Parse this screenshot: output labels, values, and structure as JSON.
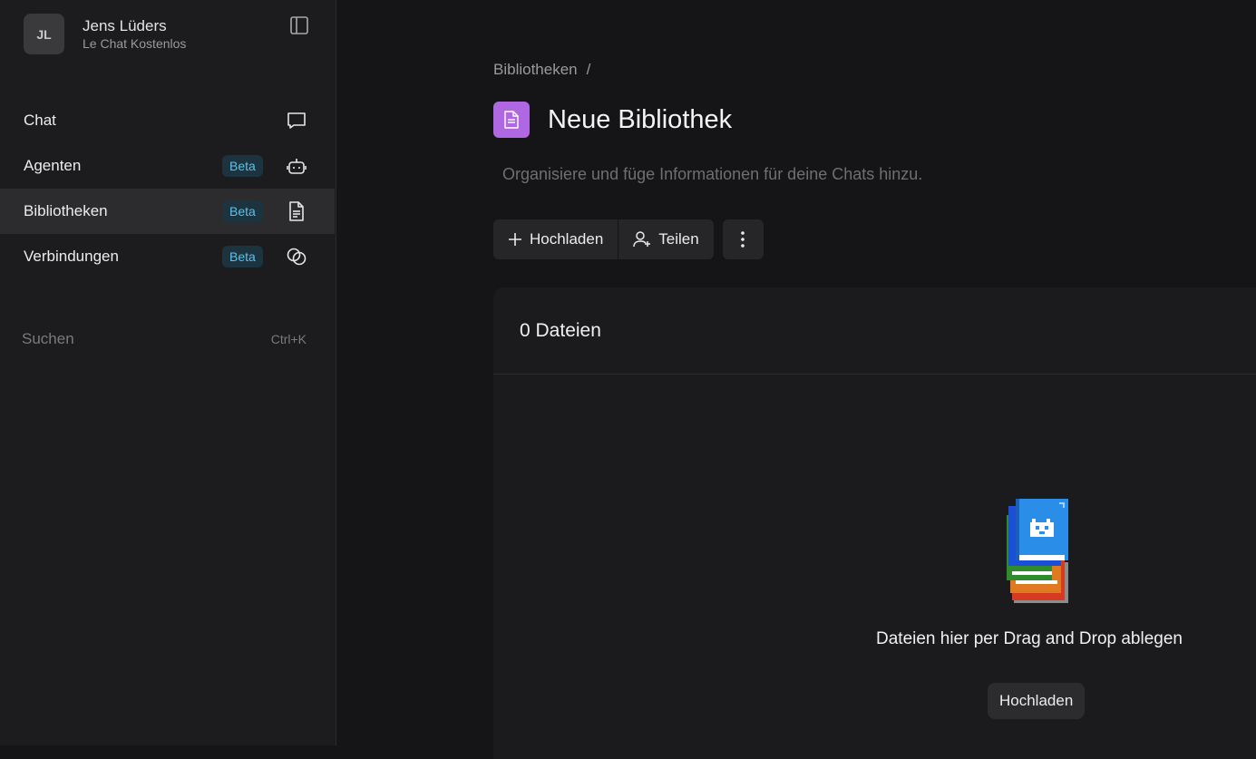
{
  "user": {
    "initials": "JL",
    "name": "Jens Lüders",
    "plan": "Le Chat Kostenlos"
  },
  "nav": [
    {
      "label": "Chat",
      "badge": null,
      "icon": "chat-bubble-icon"
    },
    {
      "label": "Agenten",
      "badge": "Beta",
      "icon": "robot-icon"
    },
    {
      "label": "Bibliotheken",
      "badge": "Beta",
      "icon": "document-icon",
      "active": true
    },
    {
      "label": "Verbindungen",
      "badge": "Beta",
      "icon": "link-circles-icon"
    }
  ],
  "search": {
    "label": "Suchen",
    "shortcut": "Ctrl+K"
  },
  "breadcrumb": {
    "root": "Bibliotheken",
    "separator": "/"
  },
  "page": {
    "title": "Neue Bibliothek",
    "subtitle": "Organisiere und füge Informationen für deine Chats hinzu."
  },
  "toolbar": {
    "upload_label": "Hochladen",
    "share_label": "Teilen"
  },
  "files": {
    "count_label": "0 Dateien",
    "drop_text": "Dateien hier per Drag and Drop ablegen",
    "upload_label": "Hochladen"
  },
  "colors": {
    "accent_purple": "#b067e2",
    "badge_bg": "#1c3340",
    "badge_text": "#58c3ea"
  }
}
